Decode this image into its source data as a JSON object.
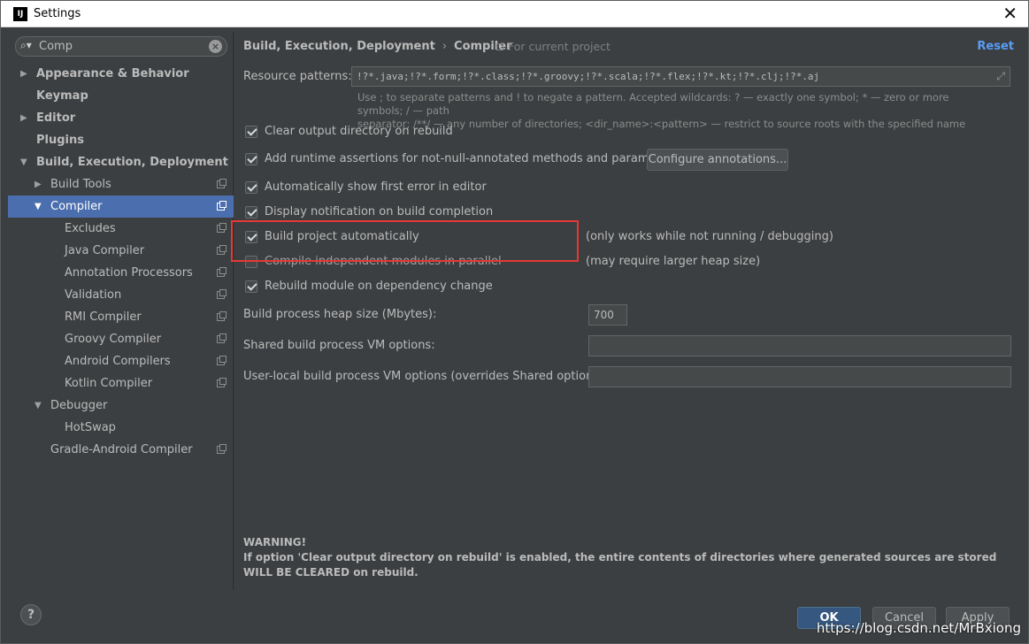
{
  "window": {
    "title": "Settings",
    "app_icon": "IJ",
    "close_glyph": "✕"
  },
  "search": {
    "value": "Comp",
    "icon": "search-icon"
  },
  "tree": [
    {
      "label": "Appearance & Behavior",
      "arrow": "▶",
      "bold": true,
      "level": 0,
      "proj": false
    },
    {
      "label": "Keymap",
      "arrow": "",
      "bold": true,
      "level": 0,
      "proj": false
    },
    {
      "label": "Editor",
      "arrow": "▶",
      "bold": true,
      "level": 0,
      "proj": false
    },
    {
      "label": "Plugins",
      "arrow": "",
      "bold": true,
      "level": 0,
      "proj": false
    },
    {
      "label": "Build, Execution, Deployment",
      "arrow": "▼",
      "bold": true,
      "level": 0,
      "proj": false
    },
    {
      "label": "Build Tools",
      "arrow": "▶",
      "bold": false,
      "level": 1,
      "proj": true
    },
    {
      "label": "Compiler",
      "arrow": "▼",
      "bold": false,
      "level": 1,
      "proj": true,
      "selected": true
    },
    {
      "label": "Excludes",
      "arrow": "",
      "bold": false,
      "level": 2,
      "proj": true
    },
    {
      "label": "Java Compiler",
      "arrow": "",
      "bold": false,
      "level": 2,
      "proj": true
    },
    {
      "label": "Annotation Processors",
      "arrow": "",
      "bold": false,
      "level": 2,
      "proj": true
    },
    {
      "label": "Validation",
      "arrow": "",
      "bold": false,
      "level": 2,
      "proj": true
    },
    {
      "label": "RMI Compiler",
      "arrow": "",
      "bold": false,
      "level": 2,
      "proj": true
    },
    {
      "label": "Groovy Compiler",
      "arrow": "",
      "bold": false,
      "level": 2,
      "proj": true
    },
    {
      "label": "Android Compilers",
      "arrow": "",
      "bold": false,
      "level": 2,
      "proj": true
    },
    {
      "label": "Kotlin Compiler",
      "arrow": "",
      "bold": false,
      "level": 2,
      "proj": true
    },
    {
      "label": "Debugger",
      "arrow": "▼",
      "bold": false,
      "level": 1,
      "proj": false
    },
    {
      "label": "HotSwap",
      "arrow": "",
      "bold": false,
      "level": 2,
      "proj": false
    },
    {
      "label": "Gradle-Android Compiler",
      "arrow": "",
      "bold": false,
      "level": 1,
      "proj": true
    }
  ],
  "breadcrumb": {
    "parent": "Build, Execution, Deployment",
    "sep": "›",
    "current": "Compiler"
  },
  "scope_label": "For current project",
  "reset_label": "Reset",
  "resource": {
    "label": "Resource patterns:",
    "value": "!?*.java;!?*.form;!?*.class;!?*.groovy;!?*.scala;!?*.flex;!?*.kt;!?*.clj;!?*.aj",
    "hint_1": "Use ; to separate patterns and ! to negate a pattern. Accepted wildcards: ? — exactly one symbol; * — zero or more symbols; / — path",
    "hint_2": "separator; /**/ — any number of directories; <dir_name>:<pattern> — restrict to source roots with the specified name"
  },
  "options": {
    "clear_output": {
      "label": "Clear output directory on rebuild",
      "checked": true
    },
    "runtime_assertions": {
      "label": "Add runtime assertions for not-null-annotated methods and parameters",
      "checked": true
    },
    "configure_annotations": "Configure annotations...",
    "show_first_error": {
      "label": "Automatically show first error in editor",
      "checked": true
    },
    "display_notification": {
      "label": "Display notification on build completion",
      "checked": true
    },
    "build_automatically": {
      "label": "Build project automatically",
      "checked": true,
      "note": "(only works while not running / debugging)"
    },
    "compile_parallel": {
      "label": "Compile independent modules in parallel",
      "checked": false,
      "note": "(may require larger heap size)"
    },
    "rebuild_module": {
      "label": "Rebuild module on dependency change",
      "checked": true
    }
  },
  "heap": {
    "label": "Build process heap size (Mbytes):",
    "value": "700"
  },
  "shared_vm": {
    "label": "Shared build process VM options:",
    "value": ""
  },
  "user_vm": {
    "label": "User-local build process VM options (overrides Shared options):",
    "value": ""
  },
  "warning": {
    "title": "WARNING!",
    "text": "If option 'Clear output directory on rebuild' is enabled, the entire contents of directories where generated sources are stored WILL BE CLEARED on rebuild."
  },
  "buttons": {
    "ok": "OK",
    "cancel": "Cancel",
    "apply": "Apply",
    "help": "?"
  },
  "watermark": "https://blog.csdn.net/MrBxiong",
  "colors": {
    "accent": "#4b6eaf",
    "link": "#589df6",
    "highlight": "#e53935",
    "bg": "#3c3f41"
  }
}
